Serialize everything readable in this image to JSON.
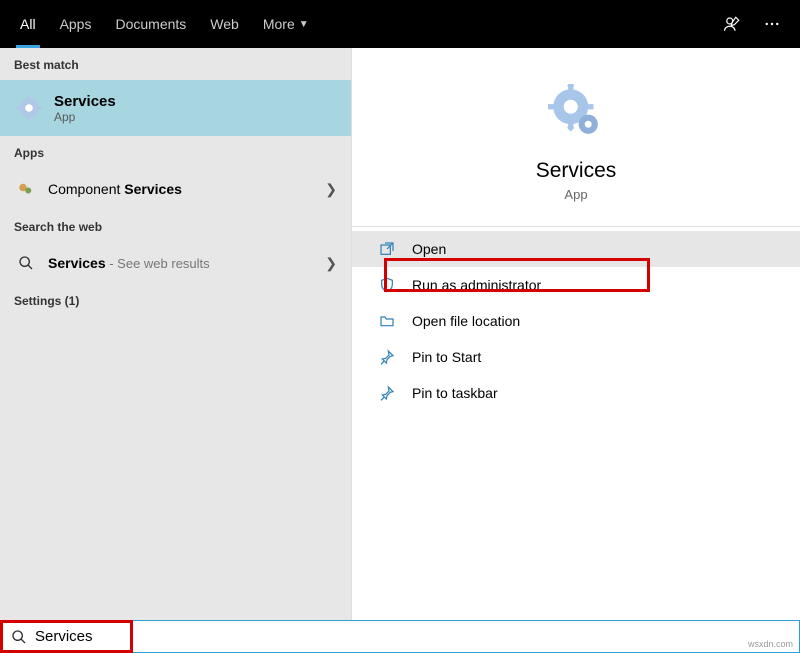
{
  "topbar": {
    "tabs": {
      "all": "All",
      "apps": "Apps",
      "documents": "Documents",
      "web": "Web",
      "more": "More"
    }
  },
  "left": {
    "best_match_header": "Best match",
    "best_match": {
      "title": "Services",
      "subtitle": "App"
    },
    "apps_header": "Apps",
    "apps_item_prefix": "Component ",
    "apps_item_bold": "Services",
    "web_header": "Search the web",
    "web_item_bold": "Services",
    "web_item_suffix": " - See web results",
    "settings_header": "Settings (1)"
  },
  "preview": {
    "title": "Services",
    "type": "App"
  },
  "actions": {
    "open": "Open",
    "run_admin": "Run as administrator",
    "open_loc": "Open file location",
    "pin_start": "Pin to Start",
    "pin_taskbar": "Pin to taskbar"
  },
  "search": {
    "value": "Services"
  },
  "watermark": "wsxdn.com"
}
